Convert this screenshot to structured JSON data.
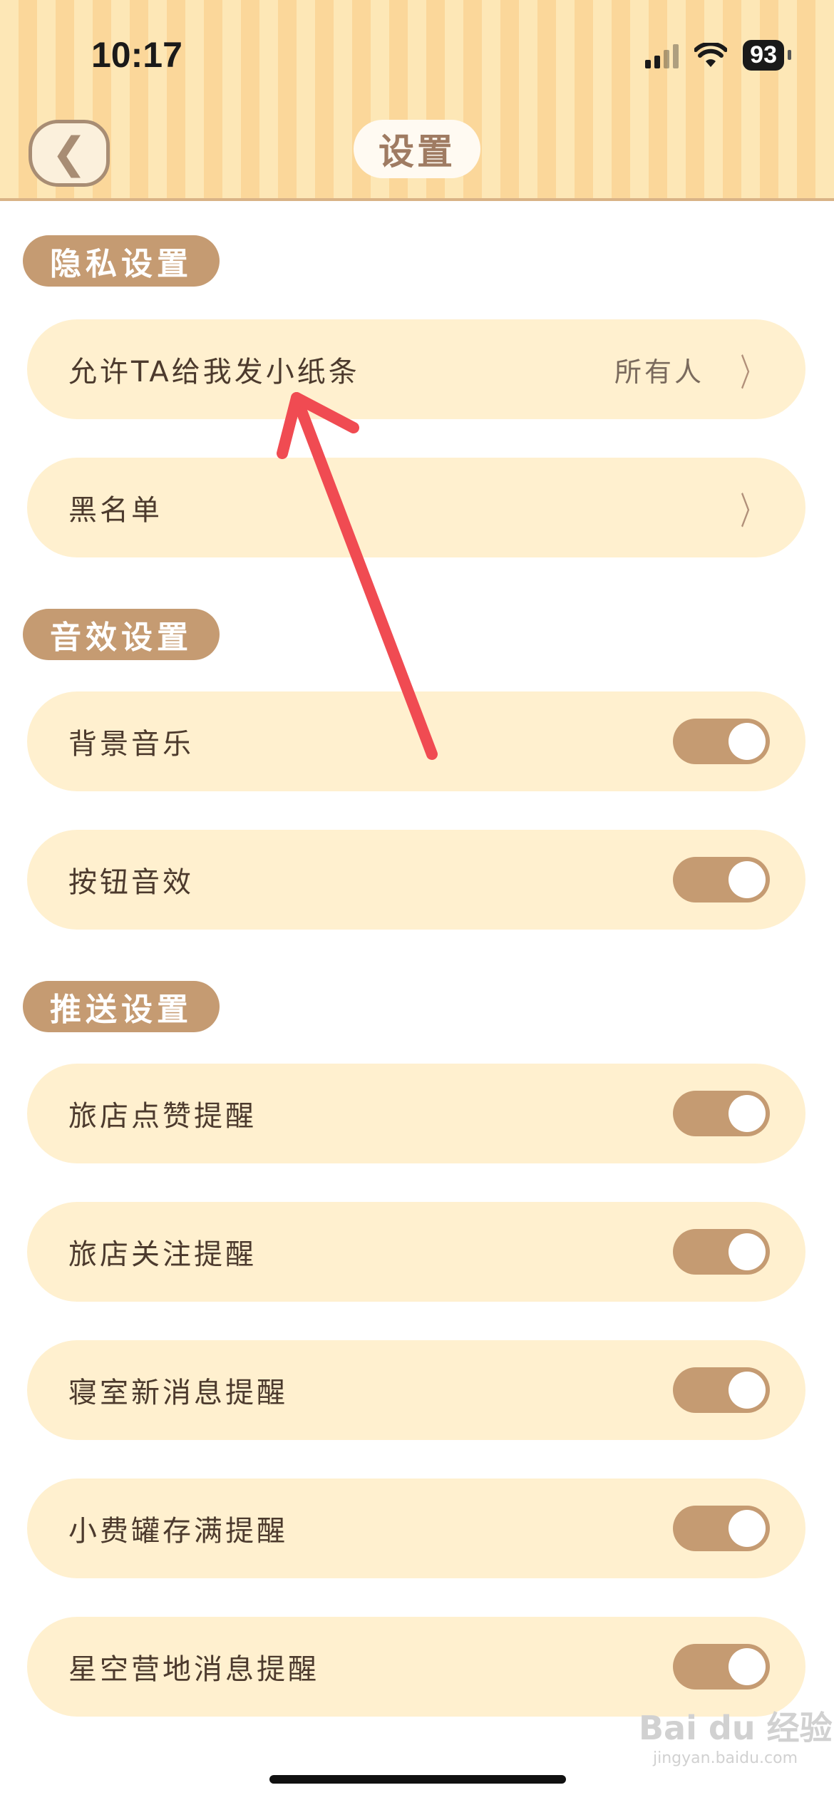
{
  "status_bar": {
    "time": "10:17",
    "battery": "93"
  },
  "header": {
    "title": "设置"
  },
  "sections": [
    {
      "label": "隐私设置",
      "rows": [
        {
          "label": "允许TA给我发小纸条",
          "value": "所有人",
          "control": "chevron"
        },
        {
          "label": "黑名单",
          "control": "chevron"
        }
      ]
    },
    {
      "label": "音效设置",
      "rows": [
        {
          "label": "背景音乐",
          "control": "toggle",
          "on": true
        },
        {
          "label": "按钮音效",
          "control": "toggle",
          "on": true
        }
      ]
    },
    {
      "label": "推送设置",
      "rows": [
        {
          "label": "旅店点赞提醒",
          "control": "toggle",
          "on": true
        },
        {
          "label": "旅店关注提醒",
          "control": "toggle",
          "on": true
        },
        {
          "label": "寝室新消息提醒",
          "control": "toggle",
          "on": true
        },
        {
          "label": "小费罐存满提醒",
          "control": "toggle",
          "on": true
        },
        {
          "label": "星空营地消息提醒",
          "control": "toggle",
          "on": true
        }
      ]
    }
  ],
  "watermark": {
    "main": "Bai du 经验",
    "sub": "jingyan.baidu.com"
  },
  "colors": {
    "accent": "#c59b72",
    "row_bg": "#fff0cf",
    "annotation_arrow": "#f04b52"
  }
}
